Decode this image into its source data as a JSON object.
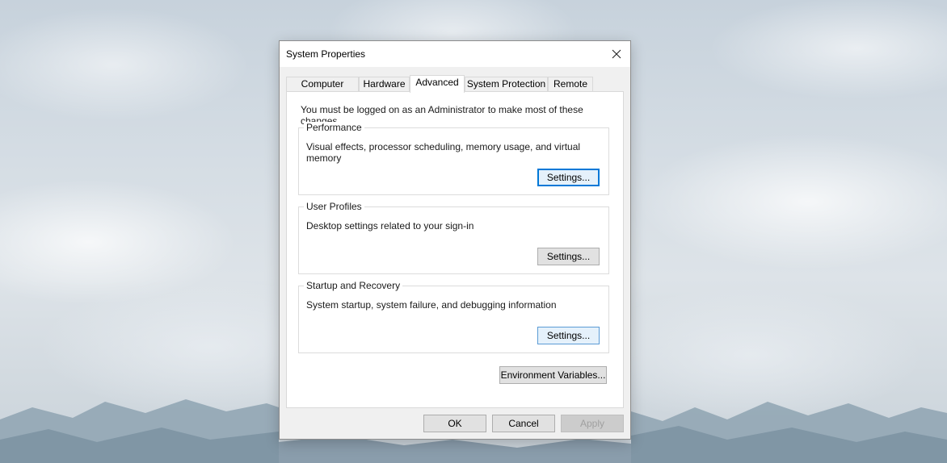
{
  "dialog": {
    "title": "System Properties",
    "close_icon": "close-icon",
    "tabs": [
      {
        "label": "Computer Name",
        "active": false
      },
      {
        "label": "Hardware",
        "active": false
      },
      {
        "label": "Advanced",
        "active": true
      },
      {
        "label": "System Protection",
        "active": false
      },
      {
        "label": "Remote",
        "active": false
      }
    ],
    "notice": "You must be logged on as an Administrator to make most of these changes.",
    "groups": [
      {
        "title": "Performance",
        "description": "Visual effects, processor scheduling, memory usage, and virtual memory",
        "button_label": "Settings..."
      },
      {
        "title": "User Profiles",
        "description": "Desktop settings related to your sign-in",
        "button_label": "Settings..."
      },
      {
        "title": "Startup and Recovery",
        "description": "System startup, system failure, and debugging information",
        "button_label": "Settings..."
      }
    ],
    "env_button_label": "Environment Variables...",
    "footer": {
      "ok_label": "OK",
      "cancel_label": "Cancel",
      "apply_label": "Apply"
    }
  },
  "colors": {
    "accent": "#0078d7",
    "dialog_bg": "#f0f0f0",
    "panel_bg": "#ffffff"
  }
}
